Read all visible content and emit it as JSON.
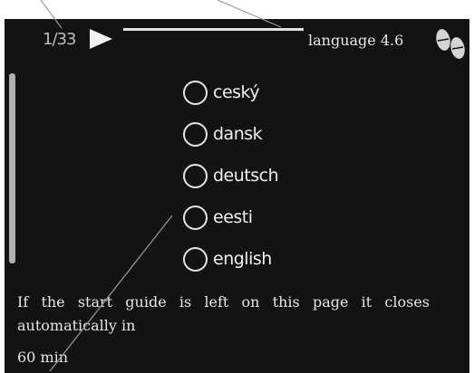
{
  "header": {
    "page_indicator": "1/33",
    "menu_title": "language  4.6",
    "next_icon": "play-arrow-icon",
    "help_icon": "footprints-icon"
  },
  "languages": [
    {
      "label": "ceský"
    },
    {
      "label": "dansk"
    },
    {
      "label": "deutsch"
    },
    {
      "label": "eesti"
    },
    {
      "label": "english"
    }
  ],
  "message": {
    "text": "If the start guide is left on this page it closes automatically in",
    "value": "60  min"
  },
  "colors": {
    "screen_bg": "#131313",
    "text": "#e6e6e6",
    "page_bg": "#ffffff"
  }
}
